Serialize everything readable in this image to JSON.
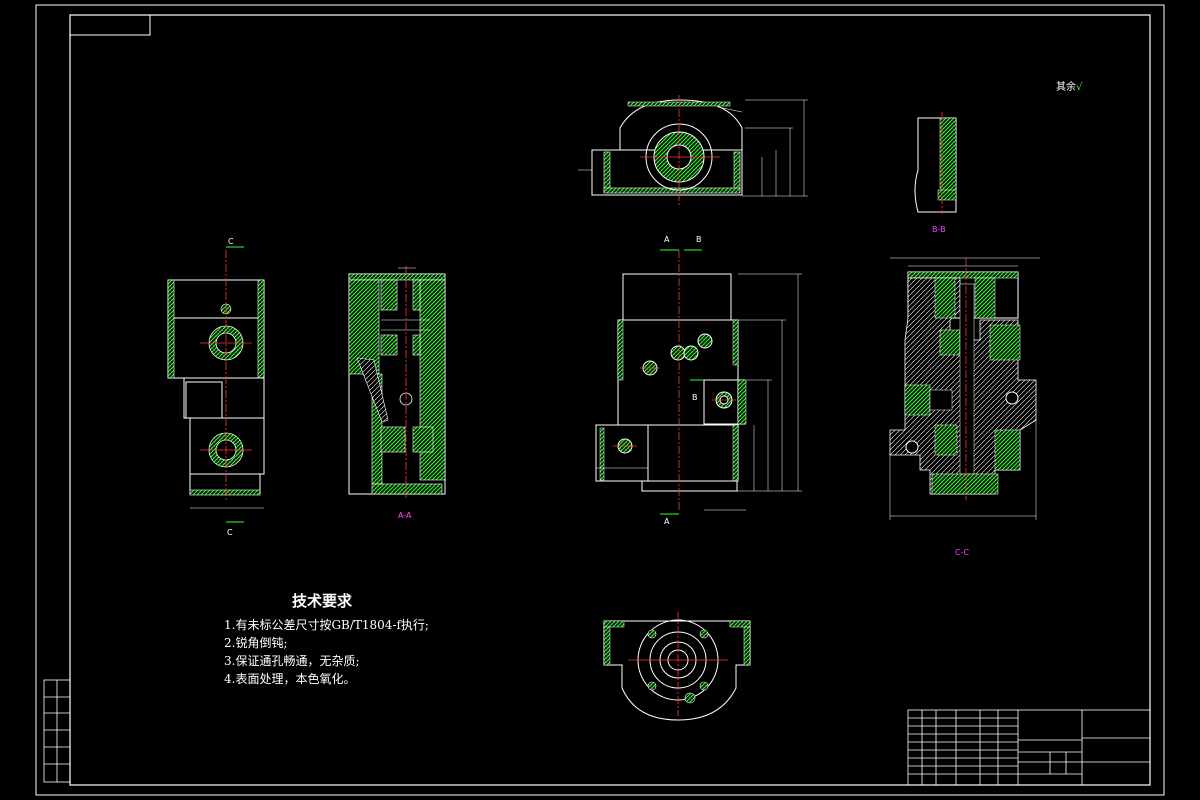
{
  "technical_requirements": {
    "title": "技术要求",
    "items": [
      "1.有未标公差尺寸按GB/T1804-f执行;",
      "2.锐角倒钝;",
      "3.保证通孔畅通，无杂质;",
      "4.表面处理，本色氧化。"
    ]
  },
  "roughness_note": {
    "text": "其余",
    "symbol": "√"
  },
  "section_labels": {
    "aa": "A-A",
    "bb": "B-B",
    "cc": "C-C",
    "c_top": "C",
    "c_bottom": "C",
    "a_top": "A",
    "b_top": "B",
    "a_bottom": "A",
    "b_side": "B"
  },
  "colors": {
    "background": "#000000",
    "outline": "#ffffff",
    "hatch": "#33ff33",
    "centerline": "#ff3333",
    "section_label": "#ff44ff",
    "leader": "#33ff33"
  }
}
